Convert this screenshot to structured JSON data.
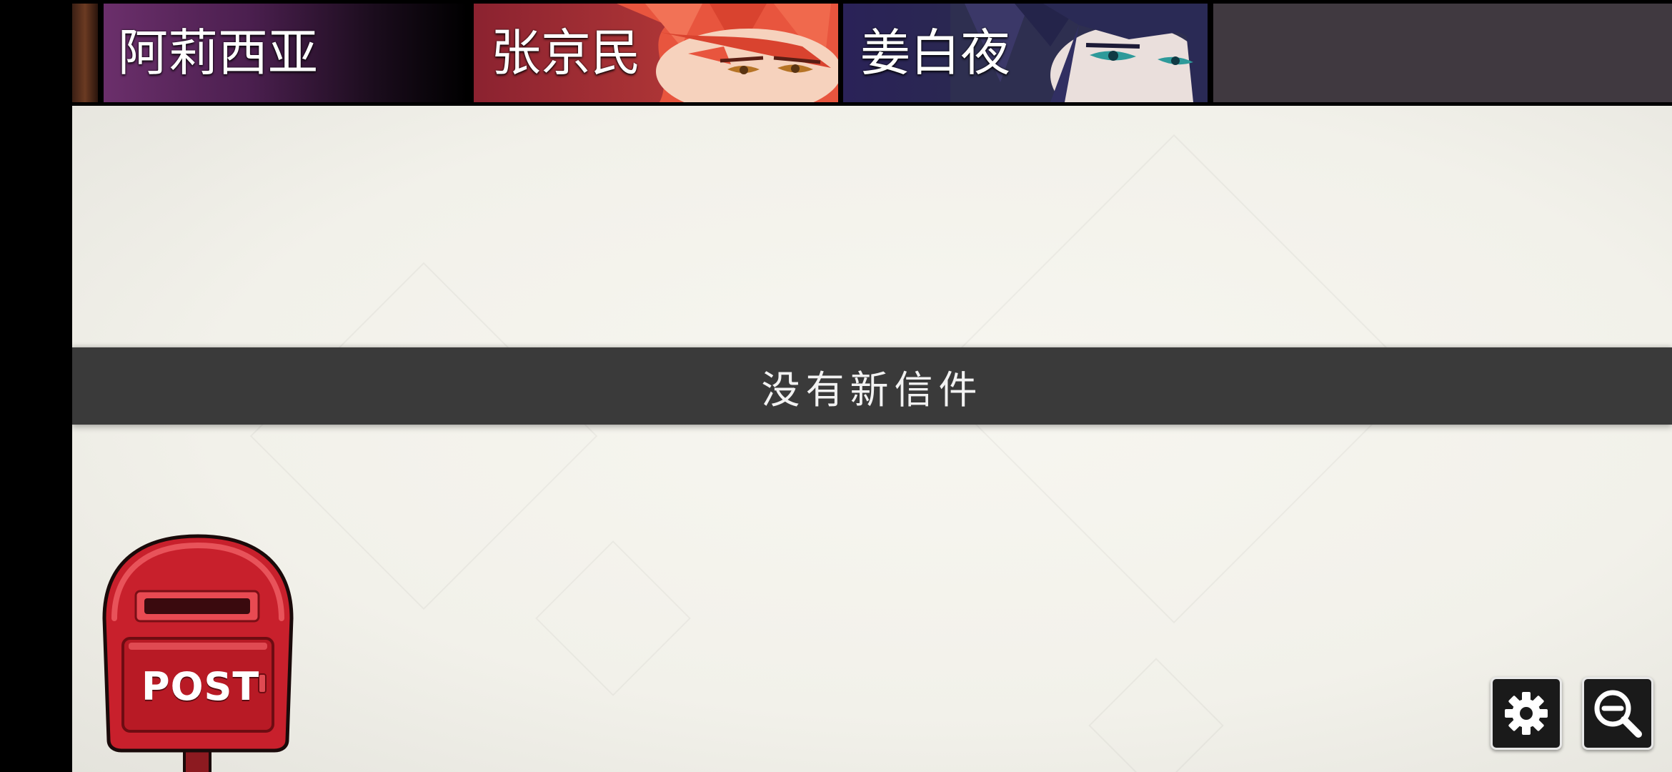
{
  "tabs": [
    {
      "name": "阿莉西亚"
    },
    {
      "name": "张京民"
    },
    {
      "name": "姜白夜"
    }
  ],
  "message": {
    "text": "没有新信件"
  },
  "postbox": {
    "label": "POST"
  },
  "buttons": {
    "settings_icon": "gear-icon",
    "zoom_icon": "zoom-out-icon"
  },
  "colors": {
    "banner": "#3a3a3a",
    "postbox_red": "#c8202c",
    "background": "#f4f3ec"
  }
}
